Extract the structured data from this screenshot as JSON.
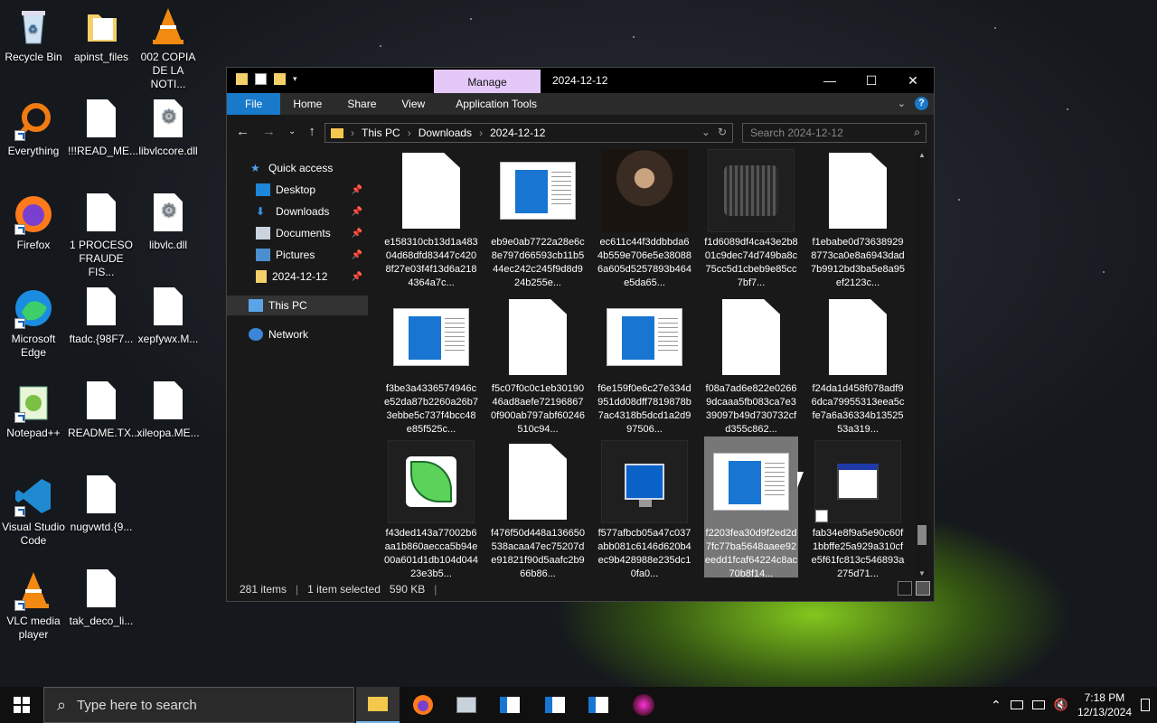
{
  "desktop": {
    "icons": [
      {
        "label": "Recycle Bin",
        "icon": "recycle-bin-icon"
      },
      {
        "label": "Everything",
        "icon": "everything-search-icon"
      },
      {
        "label": "Firefox",
        "icon": "firefox-icon"
      },
      {
        "label": "Microsoft Edge",
        "icon": "edge-icon"
      },
      {
        "label": "Notepad++",
        "icon": "notepadpp-icon"
      },
      {
        "label": "Visual Studio Code",
        "icon": "vscode-icon"
      },
      {
        "label": "VLC media player",
        "icon": "vlc-icon"
      },
      {
        "label": "apinst_files",
        "icon": "folder-icon"
      },
      {
        "label": "!!!READ_ME...",
        "icon": "document-icon"
      },
      {
        "label": "1 PROCESO FRAUDE FIS...",
        "icon": "document-icon"
      },
      {
        "label": "ftadc.{98F7...",
        "icon": "document-icon"
      },
      {
        "label": "README.TX...",
        "icon": "document-icon"
      },
      {
        "label": "nugvwtd.{9...",
        "icon": "document-icon"
      },
      {
        "label": "tak_deco_li...",
        "icon": "document-icon"
      },
      {
        "label": "002 COPIA DE LA NOTI...",
        "icon": "vlc-icon"
      },
      {
        "label": "libvlccore.dll",
        "icon": "dll-gear-icon"
      },
      {
        "label": "libvlc.dll",
        "icon": "dll-gear-icon"
      },
      {
        "label": "xepfywx.M...",
        "icon": "document-icon"
      },
      {
        "label": "xileopa.ME...",
        "icon": "document-icon"
      }
    ]
  },
  "explorer": {
    "manage_tab": "Manage",
    "title": "2024-12-12",
    "ribbon_tabs": [
      "File",
      "Home",
      "Share",
      "View",
      "Application Tools"
    ],
    "breadcrumb": [
      "This PC",
      "Downloads",
      "2024-12-12"
    ],
    "search_placeholder": "Search 2024-12-12",
    "nav": {
      "quick_access": "Quick access",
      "items": [
        "Desktop",
        "Downloads",
        "Documents",
        "Pictures",
        "2024-12-12"
      ],
      "this_pc": "This PC",
      "network": "Network"
    },
    "files": [
      {
        "name": "e158310cb13d1a48304d68dfd83447c4208f27e03f4f13d6a2184364a7c...",
        "thumb": "doc"
      },
      {
        "name": "eb9e0ab7722a28e6c8e797d66593cb11b544ec242c245f9d8d924b255e...",
        "thumb": "app"
      },
      {
        "name": "ec611c44f3ddbbda64b559e706e5e380886a605d5257893b464e5da65...",
        "thumb": "photo"
      },
      {
        "name": "f1d6089df4ca43e2b801c9dec74d749ba8c75cc5d1cbeb9e85cc7bf7...",
        "thumb": "blur"
      },
      {
        "name": "f1ebabe0d736389298773ca0e8a6943dad7b9912bd3ba5e8a95ef2123c...",
        "thumb": "doc"
      },
      {
        "name": "f3be3a4336574946ce52da87b2260a26b73ebbe5c737f4bcc48e85f525c...",
        "thumb": "app"
      },
      {
        "name": "f5c07f0c0c1eb3019046ad8aefe721968670f900ab797abf60246510c94...",
        "thumb": "doc"
      },
      {
        "name": "f6e159f0e6c27e334d951dd08dff7819878b7ac4318b5dcd1a2d997506...",
        "thumb": "app"
      },
      {
        "name": "f08a7ad6e822e02669dcaaa5fb083ca7e339097b49d730732cfd355c862...",
        "thumb": "doc"
      },
      {
        "name": "f24da1d458f078adf96dca79955313eea5cfe7a6a36334b1352553a319...",
        "thumb": "doc"
      },
      {
        "name": "f43ded143a77002b6aa1b860aecca5b94e00a601d1db104d04423e3b5...",
        "thumb": "leaf"
      },
      {
        "name": "f476f50d448a136650538acaa47ec75207de91821f90d5aafc2b966b86...",
        "thumb": "doc"
      },
      {
        "name": "f577afbcb05a47c037abb081c6146d620b4ec9b428988e235dc10fa0...",
        "thumb": "term"
      },
      {
        "name": "f2203fea30d9f2ed2d7fc77ba5648aaee92eedd1fcaf64224c8ac70b8f14...",
        "thumb": "app",
        "selected": true
      },
      {
        "name": "fab34e8f9a5e90c60f1bbffe25a929a310cfe5f61fc813c546893a275d71...",
        "thumb": "win"
      }
    ],
    "status": {
      "items": "281 items",
      "selected": "1 item selected",
      "size": "590 KB"
    }
  },
  "taskbar": {
    "search_placeholder": "Type here to search",
    "time": "7:18 PM",
    "date": "12/13/2024"
  }
}
